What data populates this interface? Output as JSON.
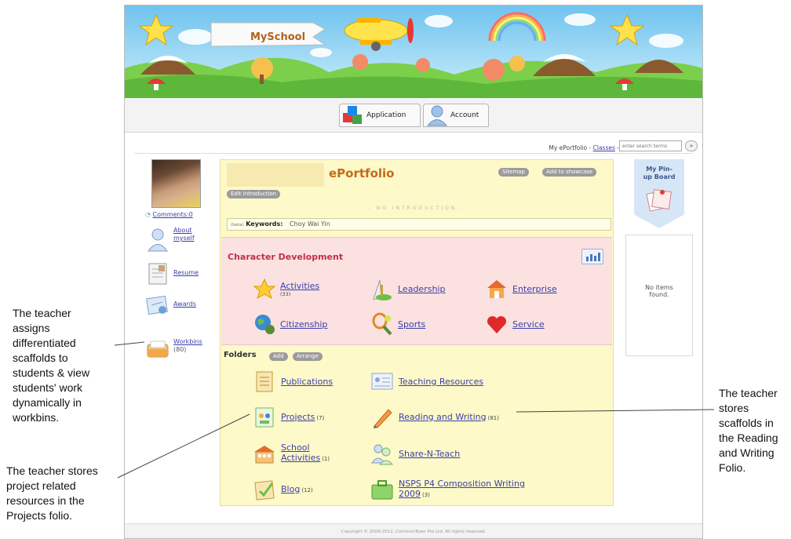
{
  "banner": {
    "logo_text": "MySchool"
  },
  "tabs": [
    {
      "label": "Application",
      "icon": "blocks-icon"
    },
    {
      "label": "Account",
      "icon": "user-icon"
    }
  ],
  "topbar": {
    "crumb_myeportfolio": "My ePortfolio",
    "crumb_sep": "-",
    "crumb_classes": "Classes",
    "crumb_sep2": "-",
    "search_placeholder": "enter search terms",
    "search_button": "»"
  },
  "left": {
    "comments": "Comments:0",
    "about_label": "About myself",
    "resume_label": "Resume",
    "awards_label": "Awards",
    "workbins_label": "Workbins",
    "workbins_count": "(80)"
  },
  "eportfolio": {
    "title": "ePortfolio",
    "sitemap": "Sitemap",
    "add_showcase": "Add to showcase",
    "edit_intro": "Edit introduction",
    "no_intro": "- NO INTRODUCTION -",
    "kw_small": "(beta)",
    "kw_label": "Keywords:",
    "kw_value": "Choy Wai Yin"
  },
  "character": {
    "title": "Character Development",
    "items": [
      {
        "label": "Activities",
        "count": "(33)"
      },
      {
        "label": "Leadership",
        "count": ""
      },
      {
        "label": "Enterprise",
        "count": ""
      },
      {
        "label": "Citizenship",
        "count": ""
      },
      {
        "label": "Sports",
        "count": ""
      },
      {
        "label": "Service",
        "count": ""
      }
    ]
  },
  "folders": {
    "title": "Folders",
    "add": "Add",
    "arrange": "Arrange",
    "items": [
      {
        "label": "Publications",
        "count": ""
      },
      {
        "label": "Teaching Resources",
        "count": ""
      },
      {
        "label": "Projects",
        "count": "(7)"
      },
      {
        "label": "Reading and Writing",
        "count": "(81)"
      },
      {
        "label": "School",
        "label2": "Activities",
        "count": "(1)"
      },
      {
        "label": "Share-N-Teach",
        "count": ""
      },
      {
        "label": "Blog",
        "count": "(12)"
      },
      {
        "label": "NSPS P4 Composition Writing",
        "label2": "2009",
        "count": "(3)"
      }
    ]
  },
  "right": {
    "pinup_title": "My Pin-up Board",
    "no_items": "No items found."
  },
  "footer": {
    "copyright": "Copyright © 2009-2012. CommonTown Pte Ltd. All rights reserved."
  },
  "annotations": {
    "left_top": [
      "The teacher",
      "assigns",
      "differentiated",
      "scaffolds to",
      "students & view",
      "students' work",
      "dynamically in",
      "workbins."
    ],
    "left_bottom": [
      "The teacher stores",
      "project related",
      "resources in the",
      "Projects folio."
    ],
    "right": [
      "The teacher",
      "stores",
      "scaffolds in",
      "the Reading",
      "and Writing",
      "Folio."
    ]
  },
  "colors": {
    "title_orange": "#c46a18",
    "character_red": "#c0304a",
    "link_blue": "#3b3fa8",
    "panel_yellow": "#fdf9c9",
    "panel_pink": "#fbe1e0"
  }
}
